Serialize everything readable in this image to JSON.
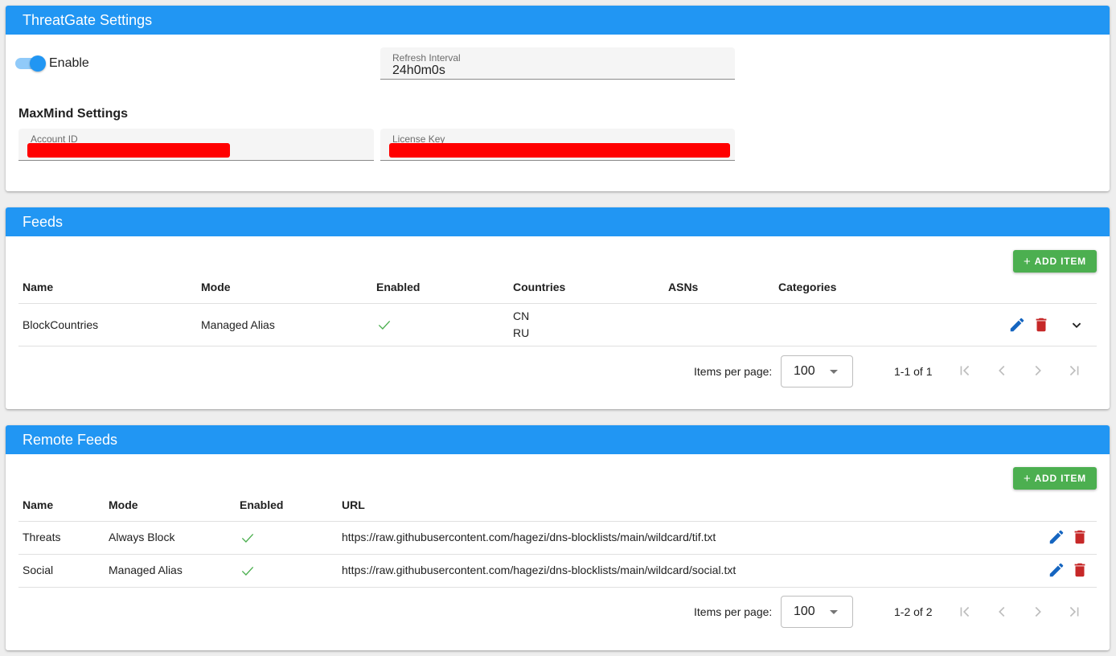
{
  "settings": {
    "title": "ThreatGate Settings",
    "enable_label": "Enable",
    "refresh_interval": {
      "label": "Refresh Interval",
      "value": "24h0m0s"
    },
    "maxmind_title": "MaxMind Settings",
    "account_id": {
      "label": "Account ID"
    },
    "license_key": {
      "label": "License Key"
    }
  },
  "feeds": {
    "title": "Feeds",
    "add_label": "ADD ITEM",
    "columns": {
      "name": "Name",
      "mode": "Mode",
      "enabled": "Enabled",
      "countries": "Countries",
      "asns": "ASNs",
      "categories": "Categories"
    },
    "rows": [
      {
        "name": "BlockCountries",
        "mode": "Managed Alias",
        "enabled": true,
        "countries": [
          "CN",
          "RU"
        ],
        "asns": "",
        "categories": ""
      }
    ],
    "pager": {
      "items_per_page_label": "Items per page:",
      "page_size": "100",
      "range": "1-1 of 1"
    }
  },
  "remote_feeds": {
    "title": "Remote Feeds",
    "add_label": "ADD ITEM",
    "columns": {
      "name": "Name",
      "mode": "Mode",
      "enabled": "Enabled",
      "url": "URL"
    },
    "rows": [
      {
        "name": "Threats",
        "mode": "Always Block",
        "enabled": true,
        "url": "https://raw.githubusercontent.com/hagezi/dns-blocklists/main/wildcard/tif.txt"
      },
      {
        "name": "Social",
        "mode": "Managed Alias",
        "enabled": true,
        "url": "https://raw.githubusercontent.com/hagezi/dns-blocklists/main/wildcard/social.txt"
      }
    ],
    "pager": {
      "items_per_page_label": "Items per page:",
      "page_size": "100",
      "range": "1-2 of 2"
    }
  },
  "colors": {
    "header": "#2196f3",
    "add_button": "#4caf50",
    "edit_icon": "#1565c0",
    "delete_icon": "#c62828",
    "check": "#4caf50",
    "redaction": "#ff0000"
  },
  "icons": [
    "plus-icon",
    "check-icon",
    "pencil-icon",
    "trash-icon",
    "chevron-down-icon",
    "first-page-icon",
    "previous-page-icon",
    "next-page-icon",
    "last-page-icon",
    "dropdown-caret-icon"
  ]
}
